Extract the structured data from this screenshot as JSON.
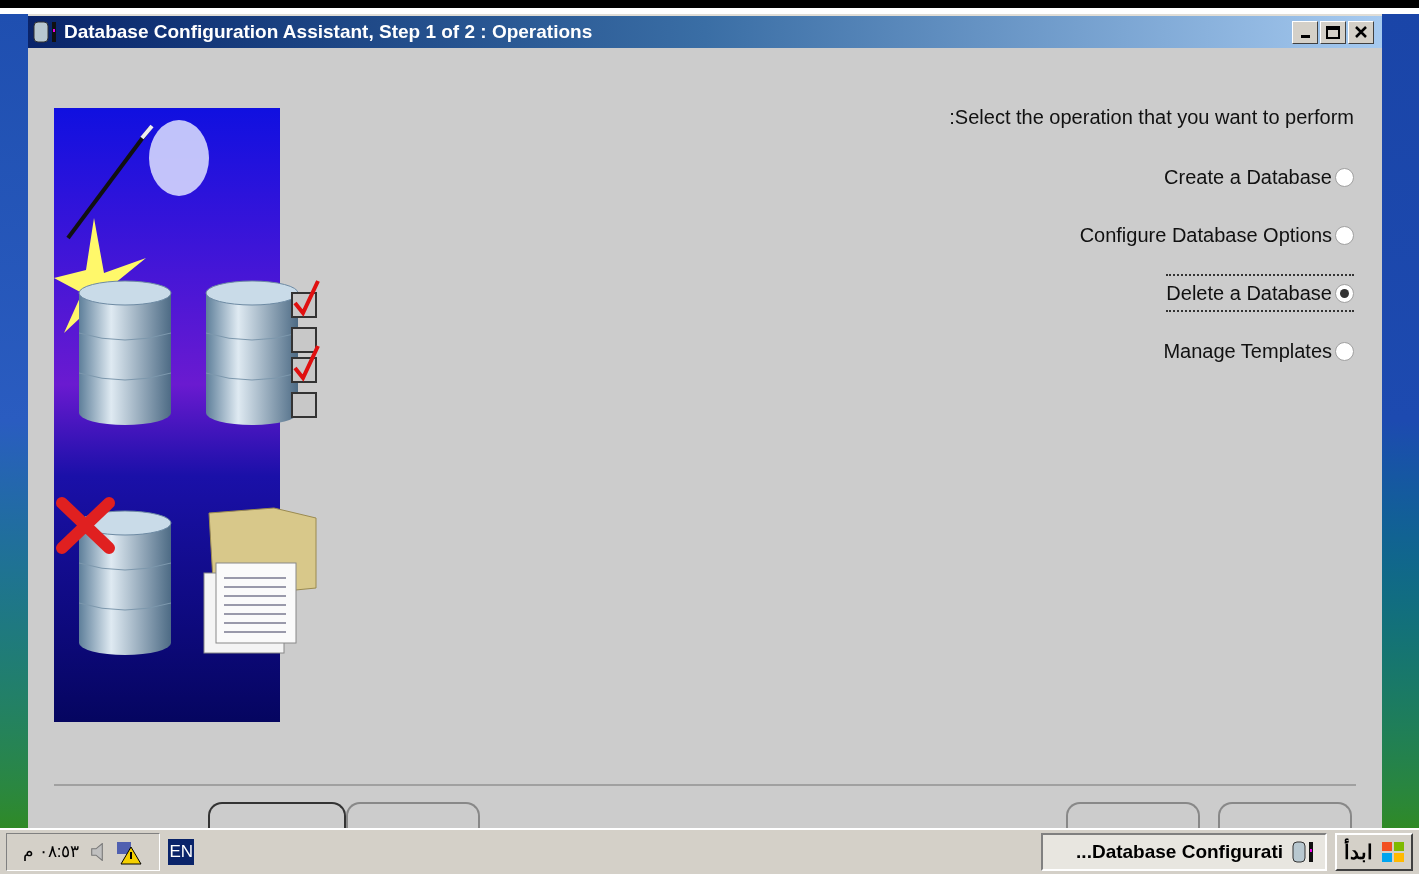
{
  "window": {
    "title": "Database Configuration Assistant, Step 1 of 2 : Operations"
  },
  "prompt": ":Select the operation that you want to perform",
  "operations": [
    {
      "label": "Create a Database",
      "selected": false,
      "focused": false
    },
    {
      "label": "Configure Database Options",
      "selected": false,
      "focused": false
    },
    {
      "label": "Delete a Database",
      "selected": true,
      "focused": true
    },
    {
      "label": "Manage Templates",
      "selected": false,
      "focused": false
    }
  ],
  "taskbar": {
    "start": "ابدأ",
    "task": "...Database Configurati",
    "language": "EN",
    "clock": "٠٨:٥٣ م"
  }
}
